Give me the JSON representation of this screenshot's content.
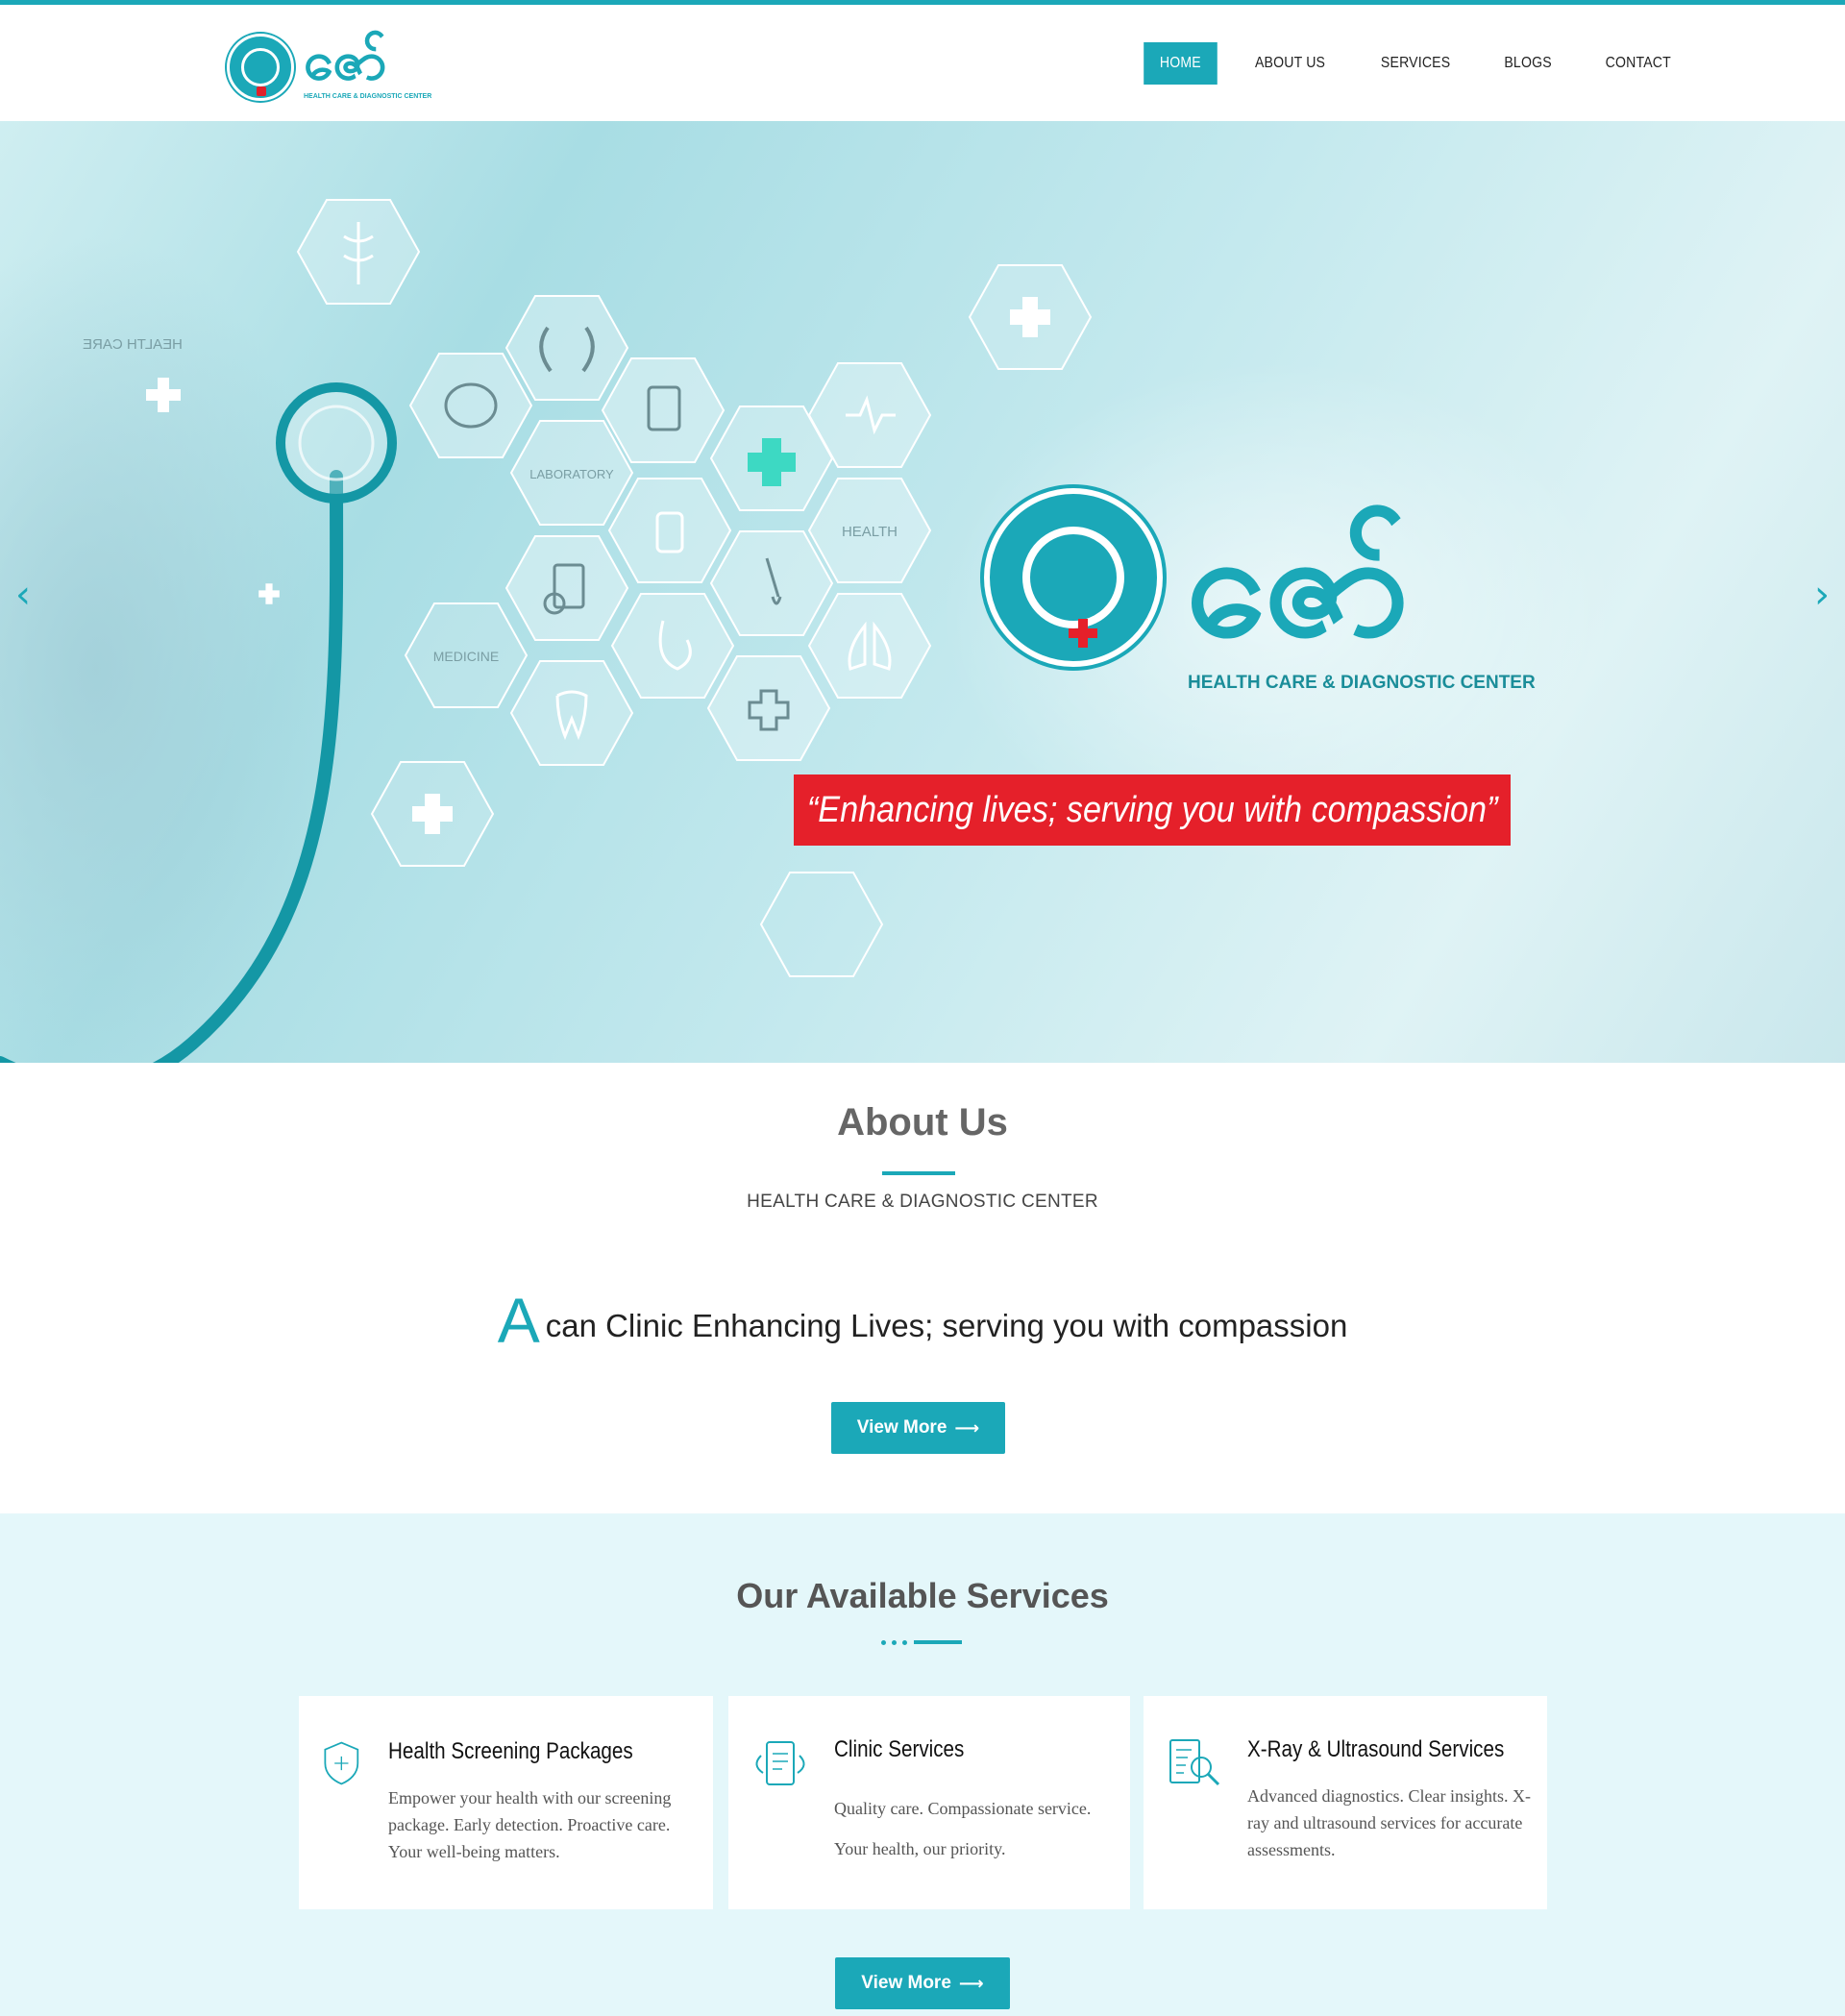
{
  "brand": {
    "logo_word": "ဇော်",
    "logo_sub": "HEALTH CARE & DIAGNOSTIC CENTER",
    "accent_color": "#1ba8b8",
    "red_color": "#e5202a"
  },
  "nav": {
    "items": [
      {
        "label": "HOME",
        "active": true
      },
      {
        "label": "ABOUT US"
      },
      {
        "label": "SERVICES"
      },
      {
        "label": "BLOGS"
      },
      {
        "label": "CONTACT"
      }
    ]
  },
  "hero": {
    "labels": [
      "LABORATORY",
      "HEALTH",
      "MEDICINE",
      "HEALTH CARE"
    ],
    "logo_word": "ဇော်",
    "logo_sub": "HEALTH CARE & DIAGNOSTIC CENTER",
    "banner_text": "“Enhancing lives; serving you with compassion”",
    "prev_icon": "chevron-left-icon",
    "next_icon": "chevron-right-icon"
  },
  "about": {
    "title": "About Us",
    "subtitle": "HEALTH CARE & DIAGNOSTIC CENTER",
    "tagline_initial": "A",
    "tagline_rest": "can Clinic Enhancing Lives; serving you with compassion",
    "button_label": "View More"
  },
  "services": {
    "title": "Our Available Services",
    "cards": [
      {
        "icon": "shield-plus-icon",
        "title": "Health Screening Packages",
        "desc": "Empower your health with our screening package. Early detection. Proactive care. Your well-being matters."
      },
      {
        "icon": "document-exchange-icon",
        "title": "Clinic Services",
        "desc": "Quality care. Compassionate service. Your health, our priority."
      },
      {
        "icon": "report-search-icon",
        "title": "X-Ray & Ultrasound Services",
        "desc": "Advanced diagnostics. Clear insights. X-ray and ultrasound services for accurate assessments."
      }
    ],
    "button_label": "View More"
  }
}
